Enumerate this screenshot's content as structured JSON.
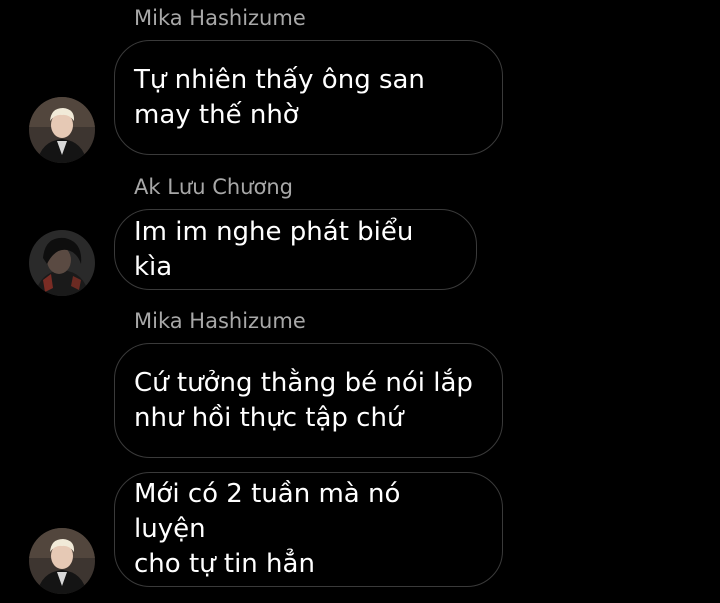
{
  "conversation": {
    "groups": [
      {
        "sender": "Mika Hashizume",
        "avatar_icon": "person-avatar-blond",
        "messages": [
          "Tự nhiên thấy ông san\nmay thế nhờ"
        ]
      },
      {
        "sender": "Ak Lưu Chương",
        "avatar_icon": "person-avatar-dark",
        "messages": [
          "Im im nghe phát biểu kìa"
        ]
      },
      {
        "sender": "Mika Hashizume",
        "avatar_icon": "person-avatar-blond",
        "messages": [
          "Cứ tưởng thằng bé nói lắp\nnhư hồi thực tập chứ",
          "Mới có 2 tuần mà nó luyện\ncho tự tin hẳn"
        ]
      }
    ]
  },
  "colors": {
    "background": "#000000",
    "bubble_border": "#3a3a3a",
    "sender_name": "#a8a8a8",
    "message_text": "#ffffff"
  }
}
